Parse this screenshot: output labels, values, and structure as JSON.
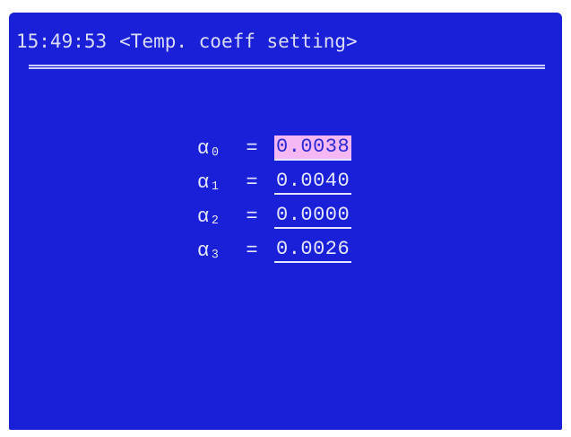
{
  "header": {
    "time": "15:49:53",
    "title": "<Temp. coeff setting>"
  },
  "coefficients": [
    {
      "label": "α₀",
      "equals": "=",
      "value": "0.0038",
      "selected": true
    },
    {
      "label": "α₁",
      "equals": "=",
      "value": "0.0040",
      "selected": false
    },
    {
      "label": "α₂",
      "equals": "=",
      "value": "0.0000",
      "selected": false
    },
    {
      "label": "α₃",
      "equals": "=",
      "value": "0.0026",
      "selected": false
    }
  ],
  "colors": {
    "screen_background": "#1a1fd8",
    "text": "#e4e6ff",
    "selection_highlight": "#f6b7f5"
  }
}
